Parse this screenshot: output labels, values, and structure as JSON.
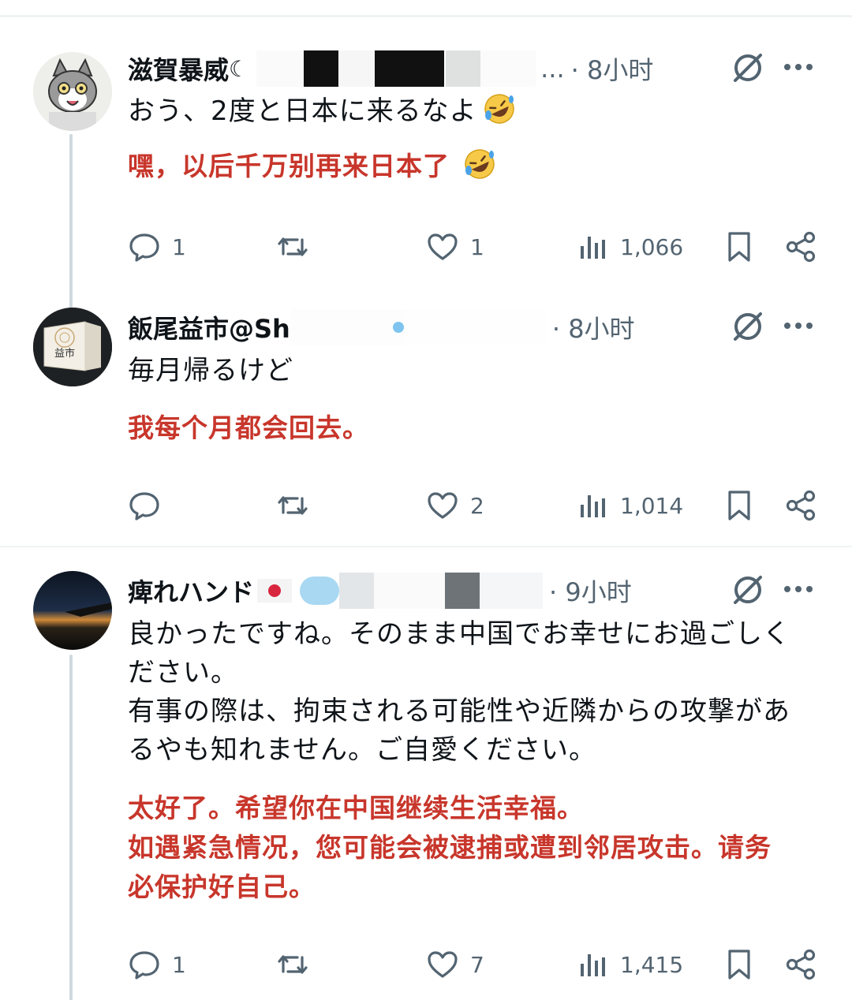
{
  "tweets": [
    {
      "name": "滋賀暴威",
      "handle_tail": "...",
      "time": "· 8小时",
      "text_lines": [
        "おう、2度と日本に来るなよ"
      ],
      "translation_lines": [
        "嘿，以后千万别再来日本了"
      ],
      "actions": {
        "replies": "1",
        "retweets": "",
        "likes": "1",
        "views": "1,066"
      }
    },
    {
      "name": "飯尾益市@Sh",
      "handle_tail": "",
      "time": "· 8小时",
      "text_lines": [
        "毎月帰るけど"
      ],
      "translation_lines": [
        "我每个月都会回去。"
      ],
      "actions": {
        "replies": "",
        "retweets": "",
        "likes": "2",
        "views": "1,014"
      },
      "avatar_text": "益市"
    },
    {
      "name": "痺れハンド",
      "handle_tail": "",
      "time": "· 9小时",
      "text_lines": [
        "良かったですね。そのまま中国でお幸せにお過ごしく",
        "ださい。",
        "有事の際は、拘束される可能性や近隣からの攻撃があ",
        "るやも知れません。ご自愛ください。"
      ],
      "translation_lines": [
        "太好了。希望你在中国继续生活幸福。",
        "如遇紧急情况，您可能会被逮捕或遭到邻居攻击。请务",
        "必保护好自己。"
      ],
      "actions": {
        "replies": "1",
        "retweets": "",
        "likes": "7",
        "views": "1,415"
      }
    }
  ],
  "colors": {
    "translation": "#c8362b",
    "secondary": "#536471",
    "thread_line": "#cfd9de",
    "divider": "#eff3f4"
  },
  "icons": [
    "reply-icon",
    "retweet-icon",
    "like-icon",
    "views-icon",
    "bookmark-icon",
    "share-icon",
    "grok-icon",
    "more-icon",
    "rofl-emoji",
    "japan-flag-icon"
  ]
}
